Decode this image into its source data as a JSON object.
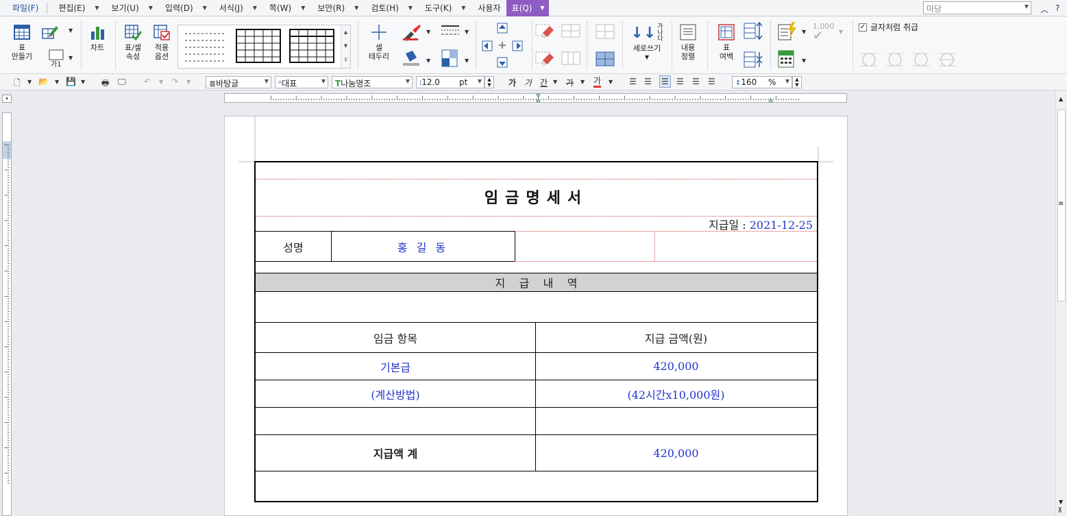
{
  "menubar": {
    "items": [
      {
        "label": "파일(F)"
      },
      {
        "label": "편집(E)"
      },
      {
        "label": "보기(U)"
      },
      {
        "label": "입력(D)"
      },
      {
        "label": "서식(J)"
      },
      {
        "label": "쪽(W)"
      },
      {
        "label": "보안(R)"
      },
      {
        "label": "검토(H)"
      },
      {
        "label": "도구(K)"
      },
      {
        "label": "사용자"
      },
      {
        "label": "표(Q)"
      }
    ],
    "style_search": "마당",
    "accent_color": "#8e5cc2"
  },
  "ribbon": {
    "make_table": "표\n만들기",
    "shape_label": "가1",
    "chart": "차트",
    "table_props": "표/셀\n속성",
    "apply_options": "적용\n옵션",
    "cell_border": "셀\n테두리",
    "vertical_writing": "세로쓰기",
    "vertical_glyphs": "가\n나\n다",
    "content_align": "내용\n정렬",
    "table_margin": "표\n여백",
    "number_format": "1,000",
    "treat_as_char": "글자처럼 취급",
    "treat_as_char_checked": true
  },
  "format": {
    "style": "바탕글",
    "lang": "대표",
    "font": "나눔명조",
    "size": "12.0",
    "unit": "pt",
    "line_spacing": "160",
    "line_unit": "%",
    "bold": "가",
    "italic": "가",
    "underline": "간",
    "strike": "가",
    "color_char": "가"
  },
  "document": {
    "title": "임금명세서",
    "paydate_label": "지급일 :",
    "paydate_value": "2021-12-25",
    "name_label": "성명",
    "name_value": "홍 길 동",
    "section_header": "지    급    내    역",
    "col_item": "임금 항목",
    "col_amount": "지급 금액(원)",
    "rows": [
      {
        "item": "기본급",
        "amount": "420,000"
      },
      {
        "item": "(계산방법)",
        "amount": "(42시간x10,000원)"
      },
      {
        "item": "",
        "amount": ""
      }
    ],
    "total_label": "지급액 계",
    "total_value": "420,000",
    "text_blue": "#2233cc",
    "guide_red": "#d44444"
  }
}
